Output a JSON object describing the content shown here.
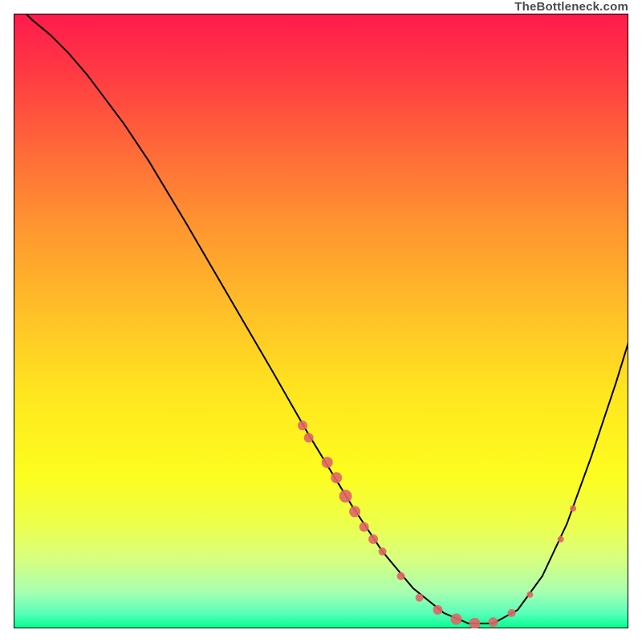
{
  "watermark": "TheBottleneck.com",
  "chart_data": {
    "type": "line",
    "title": "",
    "xlabel": "",
    "ylabel": "",
    "xlim": [
      0,
      100
    ],
    "ylim": [
      0,
      100
    ],
    "background": "rainbow-gradient-vertical",
    "curve": {
      "name": "bottleneck-curve",
      "color": "#000000",
      "points": [
        {
          "x": 0.0,
          "y": 102.0
        },
        {
          "x": 3.0,
          "y": 99.0
        },
        {
          "x": 6.0,
          "y": 96.5
        },
        {
          "x": 9.0,
          "y": 93.5
        },
        {
          "x": 12.0,
          "y": 90.0
        },
        {
          "x": 15.0,
          "y": 86.0
        },
        {
          "x": 18.0,
          "y": 82.0
        },
        {
          "x": 22.0,
          "y": 76.0
        },
        {
          "x": 28.0,
          "y": 66.0
        },
        {
          "x": 35.0,
          "y": 54.0
        },
        {
          "x": 42.0,
          "y": 42.0
        },
        {
          "x": 48.0,
          "y": 31.5
        },
        {
          "x": 55.0,
          "y": 20.0
        },
        {
          "x": 60.0,
          "y": 12.5
        },
        {
          "x": 65.0,
          "y": 6.5
        },
        {
          "x": 70.0,
          "y": 2.5
        },
        {
          "x": 74.0,
          "y": 0.8
        },
        {
          "x": 78.0,
          "y": 0.8
        },
        {
          "x": 82.0,
          "y": 3.0
        },
        {
          "x": 86.0,
          "y": 8.5
        },
        {
          "x": 90.0,
          "y": 17.0
        },
        {
          "x": 94.0,
          "y": 28.0
        },
        {
          "x": 98.0,
          "y": 40.0
        },
        {
          "x": 100.0,
          "y": 46.5
        }
      ]
    },
    "markers": {
      "name": "highlighted-points",
      "color": "#e06666",
      "points": [
        {
          "x": 47.0,
          "y": 33.0,
          "r": 6
        },
        {
          "x": 48.0,
          "y": 31.0,
          "r": 6
        },
        {
          "x": 51.0,
          "y": 27.0,
          "r": 7
        },
        {
          "x": 52.5,
          "y": 24.5,
          "r": 7
        },
        {
          "x": 54.0,
          "y": 21.5,
          "r": 8
        },
        {
          "x": 55.5,
          "y": 19.0,
          "r": 7
        },
        {
          "x": 57.0,
          "y": 16.5,
          "r": 6
        },
        {
          "x": 58.5,
          "y": 14.5,
          "r": 6
        },
        {
          "x": 60.0,
          "y": 12.5,
          "r": 5
        },
        {
          "x": 63.0,
          "y": 8.5,
          "r": 5
        },
        {
          "x": 66.0,
          "y": 5.0,
          "r": 5
        },
        {
          "x": 69.0,
          "y": 3.0,
          "r": 6
        },
        {
          "x": 72.0,
          "y": 1.5,
          "r": 7
        },
        {
          "x": 75.0,
          "y": 0.8,
          "r": 7
        },
        {
          "x": 78.0,
          "y": 1.0,
          "r": 6
        },
        {
          "x": 81.0,
          "y": 2.5,
          "r": 5
        },
        {
          "x": 84.0,
          "y": 5.5,
          "r": 4
        },
        {
          "x": 89.0,
          "y": 14.5,
          "r": 4
        },
        {
          "x": 91.0,
          "y": 19.5,
          "r": 4
        }
      ]
    }
  }
}
